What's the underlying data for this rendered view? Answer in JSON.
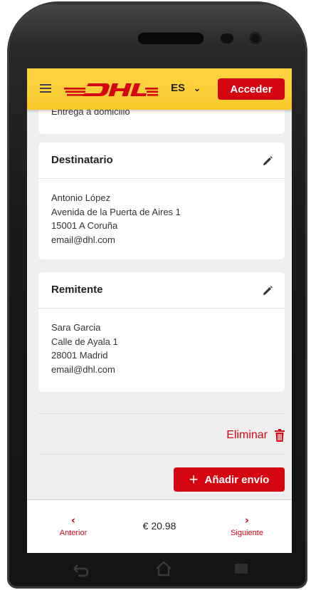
{
  "header": {
    "brand": "DHL",
    "language": "ES",
    "login_label": "Acceder",
    "brand_colors": {
      "yellow": "#FFCC00",
      "red": "#D40511"
    }
  },
  "previous_section": {
    "text": "Entrega a domicilio"
  },
  "recipient": {
    "title": "Destinatario",
    "lines": [
      "Antonio López",
      "Avenida de la Puerta de Aires 1",
      "15001 A Coruña",
      "email@dhl.com"
    ]
  },
  "sender": {
    "title": "Remitente",
    "lines": [
      "Sara Garcia",
      "Calle de Ayala 1",
      "28001 Madrid",
      "email@dhl.com"
    ]
  },
  "actions": {
    "delete_label": "Eliminar",
    "add_shipment_label": "Añadir envío",
    "add_icon": "+"
  },
  "footer": {
    "previous_label": "Anterior",
    "next_label": "Siguiente",
    "total": "€ 20.98",
    "prev_icon": "‹",
    "next_icon": "›"
  },
  "icons": {
    "menu": "hamburger-icon",
    "edit": "pencil-icon",
    "delete": "trash-icon",
    "device_nav": [
      "back-icon",
      "home-icon",
      "recent-apps-icon"
    ]
  }
}
